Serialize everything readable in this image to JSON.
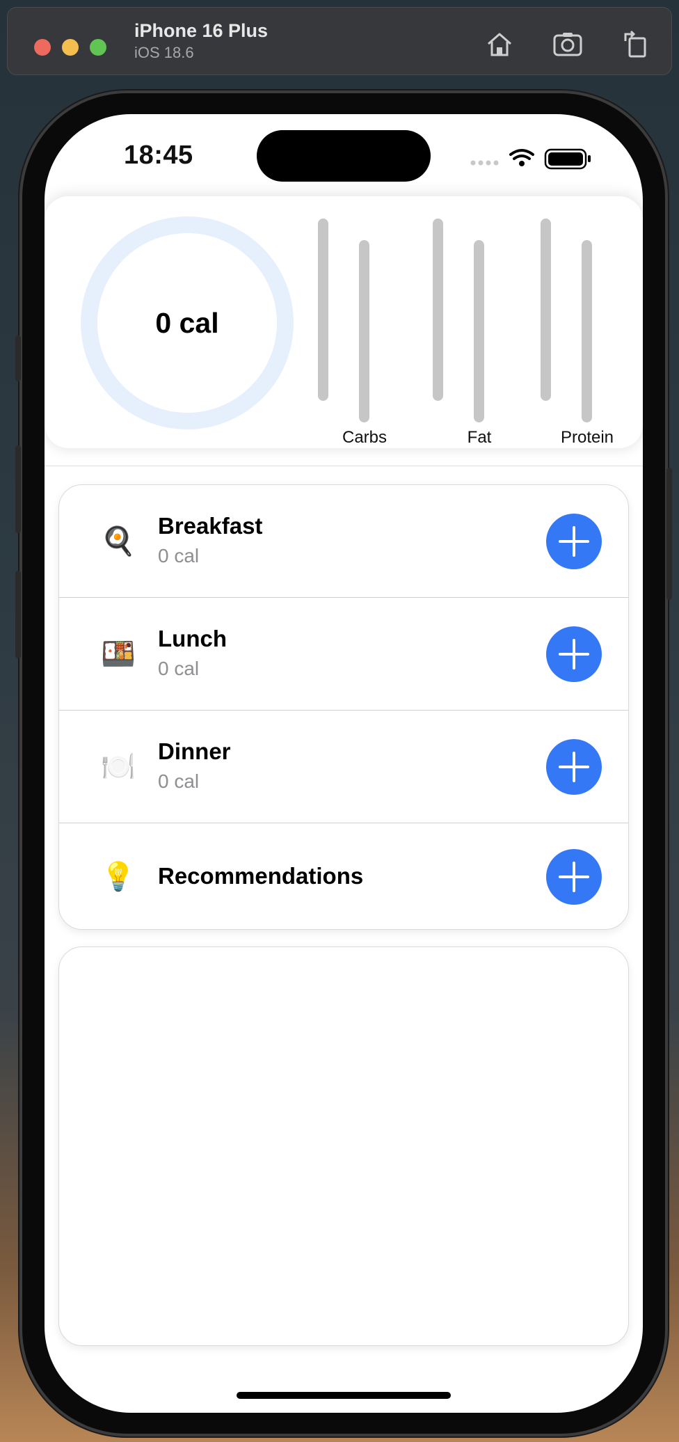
{
  "simulator": {
    "device_name": "iPhone 16 Plus",
    "os_version": "iOS 18.6",
    "icons": [
      "home-icon",
      "screenshot-icon",
      "rotate-icon"
    ]
  },
  "status_bar": {
    "time": "18:45",
    "icons": [
      "cellular-icon",
      "wifi-icon",
      "battery-icon"
    ]
  },
  "summary": {
    "calories_label": "0 cal",
    "ring_color": "#e6f0fd",
    "macros": [
      {
        "label": "Carbs"
      },
      {
        "label": "Fat"
      },
      {
        "label": "Protein"
      }
    ],
    "bar_color": "#c6c6c6"
  },
  "meals": [
    {
      "emoji": "🍳",
      "icon": "frying-pan-icon",
      "title": "Breakfast",
      "calories": "0 cal"
    },
    {
      "emoji": "🍱",
      "icon": "bento-box-icon",
      "title": "Lunch",
      "calories": "0 cal"
    },
    {
      "emoji": "🍽️",
      "icon": "plate-icon",
      "title": "Dinner",
      "calories": "0 cal"
    },
    {
      "emoji": "💡",
      "icon": "light-bulb-icon",
      "title": "Recommendations",
      "calories": ""
    }
  ],
  "accent_color": "#3478f6"
}
